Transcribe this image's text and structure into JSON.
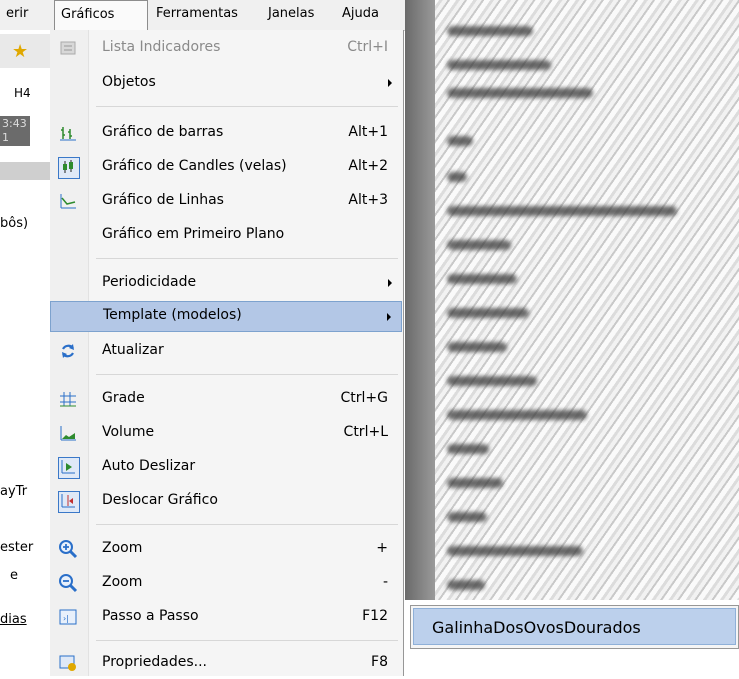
{
  "menubar": {
    "items": [
      "erir",
      "Gráficos",
      "Ferramentas",
      "Janelas",
      "Ajuda"
    ]
  },
  "left_panel": {
    "timeframe": "H4",
    "time_top": "3:43",
    "time_bottom": "1",
    "texts": [
      "bôs)",
      "ayTr",
      "ester",
      "e",
      "dias"
    ]
  },
  "menu": {
    "items": [
      {
        "label": "Lista Indicadores",
        "shortcut": "Ctrl+I",
        "icon": "indicator-list-icon",
        "disabled": true
      },
      {
        "label": "Objetos",
        "shortcut": "",
        "icon": "",
        "submenu": true
      },
      {
        "label": "Gráfico de barras",
        "shortcut": "Alt+1",
        "icon": "bar-chart-icon"
      },
      {
        "label": "Gráfico de Candles (velas)",
        "shortcut": "Alt+2",
        "icon": "candle-chart-icon"
      },
      {
        "label": "Gráfico de Linhas",
        "shortcut": "Alt+3",
        "icon": "line-chart-icon"
      },
      {
        "label": "Gráfico em Primeiro Plano",
        "shortcut": "",
        "icon": ""
      },
      {
        "label": "Periodicidade",
        "shortcut": "",
        "icon": "",
        "submenu": true
      },
      {
        "label": "Template (modelos)",
        "shortcut": "",
        "icon": "",
        "submenu": true,
        "highlighted": true
      },
      {
        "label": "Atualizar",
        "shortcut": "",
        "icon": "refresh-icon"
      },
      {
        "label": "Grade",
        "shortcut": "Ctrl+G",
        "icon": "grid-icon"
      },
      {
        "label": "Volume",
        "shortcut": "Ctrl+L",
        "icon": "volume-icon"
      },
      {
        "label": "Auto Deslizar",
        "shortcut": "",
        "icon": "auto-scroll-icon"
      },
      {
        "label": "Deslocar Gráfico",
        "shortcut": "",
        "icon": "chart-shift-icon"
      },
      {
        "label": "Zoom",
        "shortcut": "+",
        "icon": "zoom-in-icon"
      },
      {
        "label": "Zoom",
        "shortcut": "-",
        "icon": "zoom-out-icon"
      },
      {
        "label": "Passo a Passo",
        "shortcut": "F12",
        "icon": "step-icon"
      },
      {
        "label": "Propriedades...",
        "shortcut": "F8",
        "icon": "properties-icon"
      }
    ]
  },
  "submenu": {
    "item": "GalinhaDosOvosDourados"
  },
  "colors": {
    "highlight": "#b3c7e6",
    "menu_bg": "#f5f5f5",
    "icon_green": "#2e8b2e",
    "icon_blue": "#2a6fc9"
  }
}
